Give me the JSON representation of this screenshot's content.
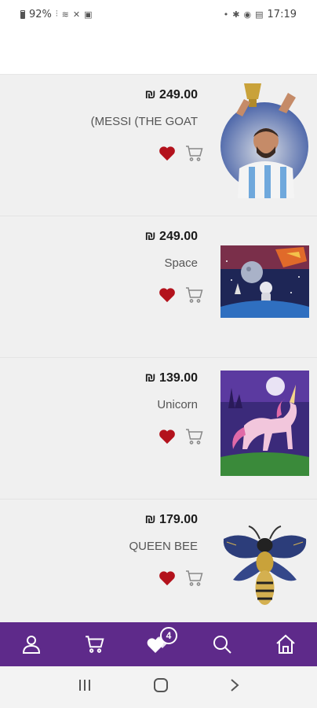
{
  "status_bar": {
    "battery": "92%",
    "time": "17:19"
  },
  "products": [
    {
      "price": "₪ 249.00",
      "title": "(MESSI (THE GOAT",
      "image": "messi-trophy-painting"
    },
    {
      "price": "₪ 249.00",
      "title": "Space",
      "image": "astronaut-space-painting"
    },
    {
      "price": "₪ 139.00",
      "title": "Unicorn",
      "image": "unicorn-castle-painting"
    },
    {
      "price": "₪ 179.00",
      "title": "QUEEN BEE",
      "image": "queen-bee-painting"
    }
  ],
  "bottom_nav": {
    "items": [
      "user-icon",
      "cart-icon",
      "hearts-icon",
      "search-icon",
      "home-icon"
    ],
    "favorites_count": "4"
  },
  "colors": {
    "accent": "#5e2a8a",
    "heart": "#b3121c",
    "list_bg": "#f0f0f0"
  }
}
